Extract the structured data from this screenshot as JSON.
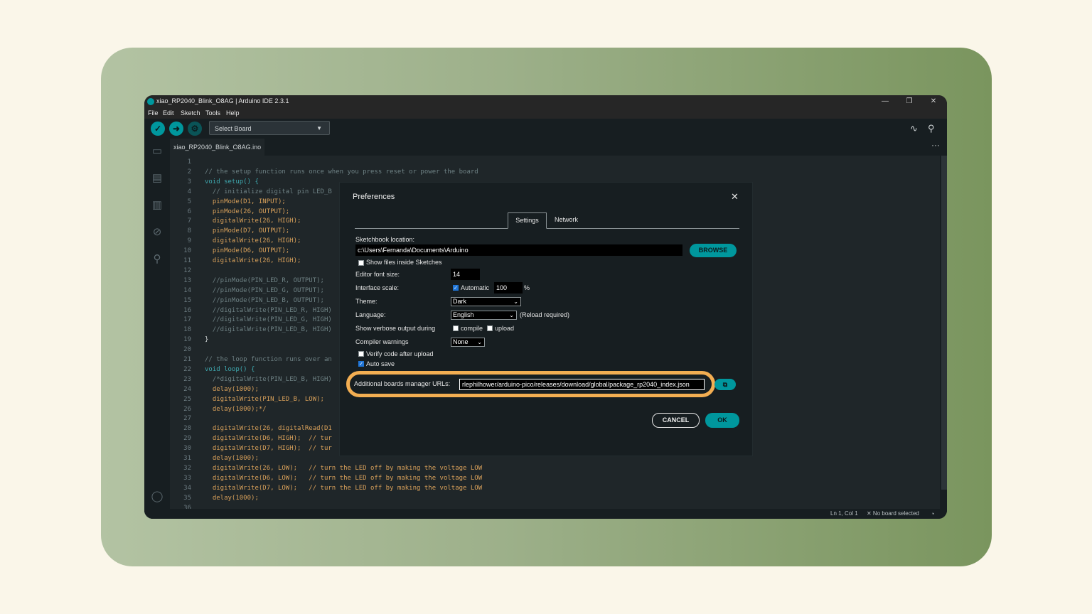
{
  "window": {
    "title": "xiao_RP2040_Blink_O8AG | Arduino IDE 2.3.1",
    "controls": {
      "minimize": "—",
      "restore": "❐",
      "close": "✕"
    }
  },
  "menu": [
    "File",
    "Edit",
    "Sketch",
    "Tools",
    "Help"
  ],
  "toolbar": {
    "verify_icon": "check-icon",
    "upload_icon": "arrow-right-icon",
    "debug_icon": "debug-icon",
    "board_select": "Select Board",
    "serial_plotter_icon": "pulse-icon",
    "serial_monitor_icon": "magnifier-icon"
  },
  "tab": {
    "name": "xiao_RP2040_Blink_O8AG.ino",
    "more": "···"
  },
  "code": [
    {
      "n": "1",
      "t": ""
    },
    {
      "n": "2",
      "t": "// the setup function runs once when you press reset or power the board"
    },
    {
      "n": "3",
      "t": "void setup() {"
    },
    {
      "n": "4",
      "t": "  // initialize digital pin LED_B"
    },
    {
      "n": "5",
      "t": "  pinMode(D1, INPUT);"
    },
    {
      "n": "6",
      "t": "  pinMode(26, OUTPUT);"
    },
    {
      "n": "7",
      "t": "  digitalWrite(26, HIGH);"
    },
    {
      "n": "8",
      "t": "  pinMode(D7, OUTPUT);"
    },
    {
      "n": "9",
      "t": "  digitalWrite(26, HIGH);"
    },
    {
      "n": "10",
      "t": "  pinMode(D6, OUTPUT);"
    },
    {
      "n": "11",
      "t": "  digitalWrite(26, HIGH);"
    },
    {
      "n": "12",
      "t": ""
    },
    {
      "n": "13",
      "t": "  //pinMode(PIN_LED_R, OUTPUT);"
    },
    {
      "n": "14",
      "t": "  //pinMode(PIN_LED_G, OUTPUT);"
    },
    {
      "n": "15",
      "t": "  //pinMode(PIN_LED_B, OUTPUT);"
    },
    {
      "n": "16",
      "t": "  //digitalWrite(PIN_LED_R, HIGH)"
    },
    {
      "n": "17",
      "t": "  //digitalWrite(PIN_LED_G, HIGH)"
    },
    {
      "n": "18",
      "t": "  //digitalWrite(PIN_LED_B, HIGH)"
    },
    {
      "n": "19",
      "t": "}"
    },
    {
      "n": "20",
      "t": ""
    },
    {
      "n": "21",
      "t": "// the loop function runs over an"
    },
    {
      "n": "22",
      "t": "void loop() {"
    },
    {
      "n": "23",
      "t": "  /*digitalWrite(PIN_LED_B, HIGH)"
    },
    {
      "n": "24",
      "t": "  delay(1000);"
    },
    {
      "n": "25",
      "t": "  digitalWrite(PIN_LED_B, LOW);"
    },
    {
      "n": "26",
      "t": "  delay(1000);*/"
    },
    {
      "n": "27",
      "t": ""
    },
    {
      "n": "28",
      "t": "  digitalWrite(26, digitalRead(D1"
    },
    {
      "n": "29",
      "t": "  digitalWrite(D6, HIGH);  // tur"
    },
    {
      "n": "30",
      "t": "  digitalWrite(D7, HIGH);  // tur"
    },
    {
      "n": "31",
      "t": "  delay(1000);"
    },
    {
      "n": "32",
      "t": "  digitalWrite(26, LOW);   // turn the LED off by making the voltage LOW"
    },
    {
      "n": "33",
      "t": "  digitalWrite(D6, LOW);   // turn the LED off by making the voltage LOW"
    },
    {
      "n": "34",
      "t": "  digitalWrite(D7, LOW);   // turn the LED off by making the voltage LOW"
    },
    {
      "n": "35",
      "t": "  delay(1000);"
    },
    {
      "n": "36",
      "t": ""
    }
  ],
  "status": {
    "position": "Ln 1, Col 1",
    "board": "✕ No board selected"
  },
  "preferences": {
    "title": "Preferences",
    "tabs": [
      "Settings",
      "Network"
    ],
    "sketchbook_label": "Sketchbook location:",
    "sketchbook_value": "c:\\Users\\Fernanda\\Documents\\Arduino",
    "browse": "BROWSE",
    "show_files": "Show files inside Sketches",
    "font_size_label": "Editor font size:",
    "font_size_value": "14",
    "scale_label": "Interface scale:",
    "scale_auto": "Automatic",
    "scale_value": "100",
    "scale_unit": "%",
    "theme_label": "Theme:",
    "theme_value": "Dark",
    "language_label": "Language:",
    "language_value": "English",
    "language_note": "(Reload required)",
    "verbose_label": "Show verbose output during",
    "verbose_compile": "compile",
    "verbose_upload": "upload",
    "warnings_label": "Compiler warnings",
    "warnings_value": "None",
    "verify_after_upload": "Verify code after upload",
    "auto_save": "Auto save",
    "urls_label": "Additional boards manager URLs:",
    "urls_value": "rlephilhower/arduino-pico/releases/download/global/package_rp2040_index.json",
    "cancel": "CANCEL",
    "ok": "OK"
  },
  "colors": {
    "accent": "#00979d",
    "highlight": "#f3ae52",
    "background": "#faf6e9"
  }
}
